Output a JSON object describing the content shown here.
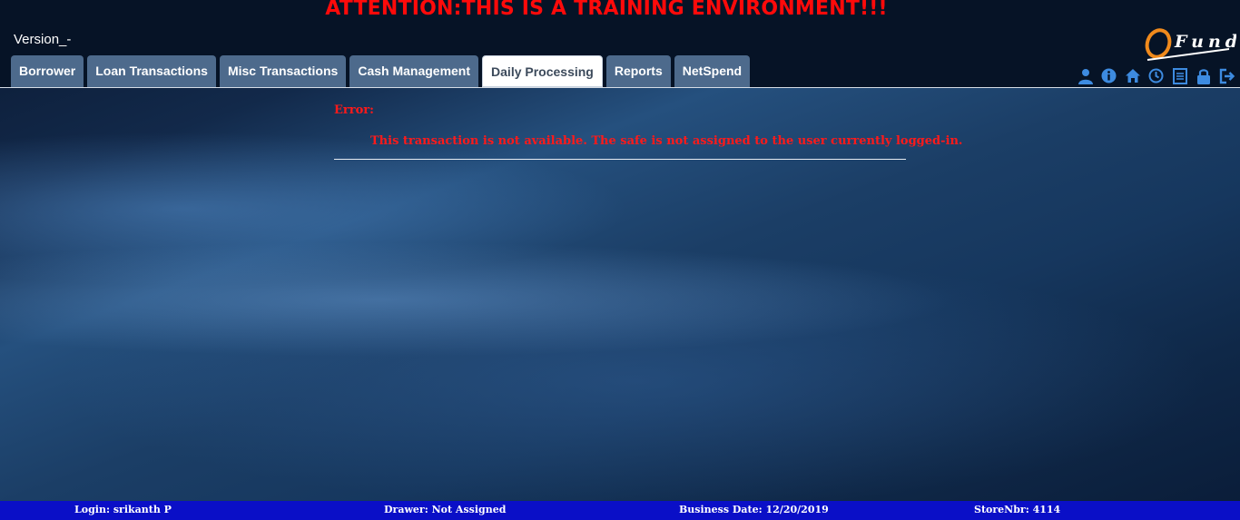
{
  "banner": {
    "text": "ATTENTION:THIS IS A TRAINING ENVIRONMENT!!!"
  },
  "header": {
    "version": "Version_-",
    "logo_text": "Fund"
  },
  "tabs": [
    {
      "label": "Borrower",
      "active": false
    },
    {
      "label": "Loan Transactions",
      "active": false
    },
    {
      "label": "Misc Transactions",
      "active": false
    },
    {
      "label": "Cash Management",
      "active": false
    },
    {
      "label": "Daily Processing",
      "active": true
    },
    {
      "label": "Reports",
      "active": false
    },
    {
      "label": "NetSpend",
      "active": false
    }
  ],
  "toolbar_icons": [
    "user-icon",
    "info-icon",
    "home-icon",
    "clock-icon",
    "list-icon",
    "lock-icon",
    "logout-icon"
  ],
  "error": {
    "title": "Error:",
    "message": "This transaction is not available. The safe is not assigned to the user currently logged-in."
  },
  "status": {
    "login": "Login: srikanth P",
    "drawer": "Drawer: Not Assigned",
    "business_date": "Business Date: 12/20/2019",
    "store": "StoreNbr: 4114"
  },
  "colors": {
    "banner_red": "#ff0a0a",
    "tab_bg": "#4d6a8c",
    "icon_blue": "#3d8be0",
    "status_blue": "#0a0fc7",
    "logo_orange": "#f08a1c"
  }
}
